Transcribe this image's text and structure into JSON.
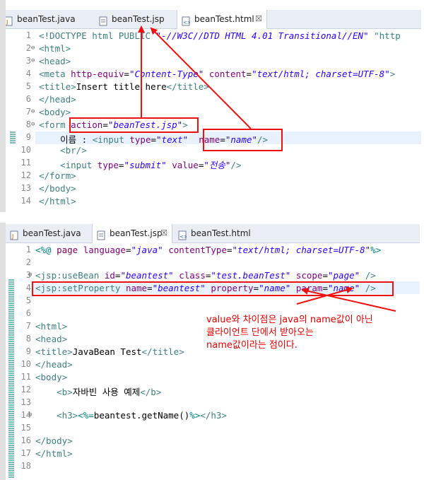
{
  "top_editor": {
    "tabs": [
      {
        "label": "beanTest.java",
        "icon": "java-file-icon"
      },
      {
        "label": "beanTest.jsp",
        "icon": "jsp-file-icon"
      },
      {
        "label": "beanTest.html",
        "icon": "html-file-icon",
        "active": true,
        "close": "☒"
      }
    ],
    "lines": [
      {
        "num": "1",
        "parts": [
          [
            "t",
            "<!DOCTYPE html PUBLIC "
          ],
          [
            "v",
            "\"-//W3C//DTD HTML 4.01 Transitional//EN\""
          ],
          [
            "t",
            " \"http"
          ]
        ]
      },
      {
        "num": "2",
        "fold": "⊖",
        "parts": [
          [
            "t",
            "<html>"
          ]
        ]
      },
      {
        "num": "3",
        "fold": "⊖",
        "parts": [
          [
            "t",
            "<head>"
          ]
        ]
      },
      {
        "num": "4",
        "parts": [
          [
            "t",
            "<meta "
          ],
          [
            "a",
            "http-equiv"
          ],
          [
            "x",
            "="
          ],
          [
            "v",
            "\"Content-Type\""
          ],
          [
            "x",
            " "
          ],
          [
            "a",
            "content"
          ],
          [
            "x",
            "="
          ],
          [
            "v",
            "\"text/html; charset=UTF-8\""
          ],
          [
            "t",
            ">"
          ]
        ]
      },
      {
        "num": "5",
        "parts": [
          [
            "t",
            "<title>"
          ],
          [
            "x",
            "Insert title here"
          ],
          [
            "t",
            "</title>"
          ]
        ]
      },
      {
        "num": "6",
        "parts": [
          [
            "t",
            "</head>"
          ]
        ]
      },
      {
        "num": "7",
        "fold": "⊖",
        "parts": [
          [
            "t",
            "<body>"
          ]
        ]
      },
      {
        "num": "8",
        "fold": "⊖",
        "parts": [
          [
            "t",
            "<form "
          ],
          [
            "a",
            "action"
          ],
          [
            "x",
            "="
          ],
          [
            "v",
            "\"beanTest.jsp\""
          ],
          [
            "t",
            ">"
          ]
        ]
      },
      {
        "num": "9",
        "parts": [
          [
            "x",
            "    이름 : "
          ],
          [
            "t",
            "<input "
          ],
          [
            "a",
            "type"
          ],
          [
            "x",
            "="
          ],
          [
            "v",
            "\"text\""
          ],
          [
            "x",
            "  "
          ],
          [
            "a",
            "name"
          ],
          [
            "x",
            "="
          ],
          [
            "v",
            "\"name\""
          ],
          [
            "t",
            "/>"
          ]
        ]
      },
      {
        "num": "10",
        "parts": [
          [
            "x",
            "    "
          ],
          [
            "t",
            "<br/>"
          ]
        ]
      },
      {
        "num": "11",
        "parts": [
          [
            "x",
            "    "
          ],
          [
            "t",
            "<input "
          ],
          [
            "a",
            "type"
          ],
          [
            "x",
            "="
          ],
          [
            "v",
            "\"submit\""
          ],
          [
            "x",
            " "
          ],
          [
            "a",
            "value"
          ],
          [
            "x",
            "="
          ],
          [
            "v",
            "\"전송\""
          ],
          [
            "t",
            "/>"
          ]
        ]
      },
      {
        "num": "12",
        "parts": [
          [
            "t",
            "</form>"
          ]
        ]
      },
      {
        "num": "13",
        "parts": [
          [
            "t",
            "</body>"
          ]
        ]
      },
      {
        "num": "14",
        "parts": [
          [
            "t",
            "</html>"
          ]
        ]
      }
    ]
  },
  "bottom_editor": {
    "tabs": [
      {
        "label": "beanTest.java",
        "icon": "java-file-icon"
      },
      {
        "label": "beanTest.jsp",
        "icon": "jsp-file-icon",
        "active": true,
        "close": "☒"
      },
      {
        "label": "beanTest.html",
        "icon": "html-file-icon"
      }
    ],
    "lines": [
      {
        "num": "1",
        "parts": [
          [
            "d",
            "<%@ "
          ],
          [
            "j",
            "page "
          ],
          [
            "a",
            "language"
          ],
          [
            "x",
            "="
          ],
          [
            "v",
            "\"java\""
          ],
          [
            "x",
            " "
          ],
          [
            "a",
            "contentType"
          ],
          [
            "x",
            "="
          ],
          [
            "v",
            "\"text/html; charset=UTF-8\""
          ],
          [
            "d",
            "%>"
          ]
        ]
      },
      {
        "num": "2",
        "parts": []
      },
      {
        "num": "3",
        "fold": "⊖",
        "parts": [
          [
            "t",
            "<jsp:useBean "
          ],
          [
            "a",
            "id"
          ],
          [
            "x",
            "="
          ],
          [
            "v",
            "\"beantest\""
          ],
          [
            "x",
            " "
          ],
          [
            "a",
            "class"
          ],
          [
            "x",
            "="
          ],
          [
            "v",
            "\"test.beanTest\""
          ],
          [
            "x",
            " "
          ],
          [
            "a",
            "scope"
          ],
          [
            "x",
            "="
          ],
          [
            "v",
            "\"page\""
          ],
          [
            "x",
            " "
          ],
          [
            "t",
            "/>"
          ]
        ]
      },
      {
        "num": "4",
        "parts": [
          [
            "t",
            "<jsp:setProperty "
          ],
          [
            "a",
            "name"
          ],
          [
            "x",
            "="
          ],
          [
            "v",
            "\"beantest\""
          ],
          [
            "x",
            " "
          ],
          [
            "a",
            "property"
          ],
          [
            "x",
            "="
          ],
          [
            "v",
            "\"name\""
          ],
          [
            "x",
            " "
          ],
          [
            "a",
            "param"
          ],
          [
            "x",
            "="
          ],
          [
            "v",
            "\"name\""
          ],
          [
            "x",
            " "
          ],
          [
            "t",
            "/>"
          ]
        ]
      },
      {
        "num": "5",
        "parts": []
      },
      {
        "num": "6",
        "parts": []
      },
      {
        "num": "7",
        "parts": [
          [
            "t",
            "<html>"
          ]
        ]
      },
      {
        "num": "8",
        "parts": [
          [
            "t",
            "<head>"
          ]
        ]
      },
      {
        "num": "9",
        "parts": [
          [
            "t",
            "<title>"
          ],
          [
            "x",
            "JavaBean Test"
          ],
          [
            "t",
            "</title>"
          ]
        ]
      },
      {
        "num": "10",
        "parts": [
          [
            "t",
            "</head>"
          ]
        ]
      },
      {
        "num": "11",
        "parts": [
          [
            "t",
            "<body>"
          ]
        ]
      },
      {
        "num": "12",
        "parts": [
          [
            "x",
            "    "
          ],
          [
            "t",
            "<b>"
          ],
          [
            "x",
            "자바빈 사용 예제"
          ],
          [
            "t",
            "</b>"
          ]
        ]
      },
      {
        "num": "13",
        "parts": []
      },
      {
        "num": "14",
        "fold": "⊖",
        "parts": [
          [
            "x",
            "    "
          ],
          [
            "t",
            "<h3>"
          ],
          [
            "d",
            "<%="
          ],
          [
            "x",
            "beantest.getName()"
          ],
          [
            "d",
            "%>"
          ],
          [
            "t",
            "</h3>"
          ]
        ]
      },
      {
        "num": "15",
        "parts": []
      },
      {
        "num": "16",
        "parts": [
          [
            "t",
            "</body>"
          ]
        ]
      },
      {
        "num": "17",
        "parts": [
          [
            "t",
            "</html>"
          ]
        ]
      },
      {
        "num": "18",
        "parts": []
      }
    ]
  },
  "annotation": {
    "lines": [
      "value와 차이점은 java의 name값이 아닌",
      "클라이언트 단에서 받아오는",
      "name값이라는 점이다."
    ]
  },
  "colors": {
    "highlight_box": "#ee1111",
    "arrow": "#ee1111"
  }
}
